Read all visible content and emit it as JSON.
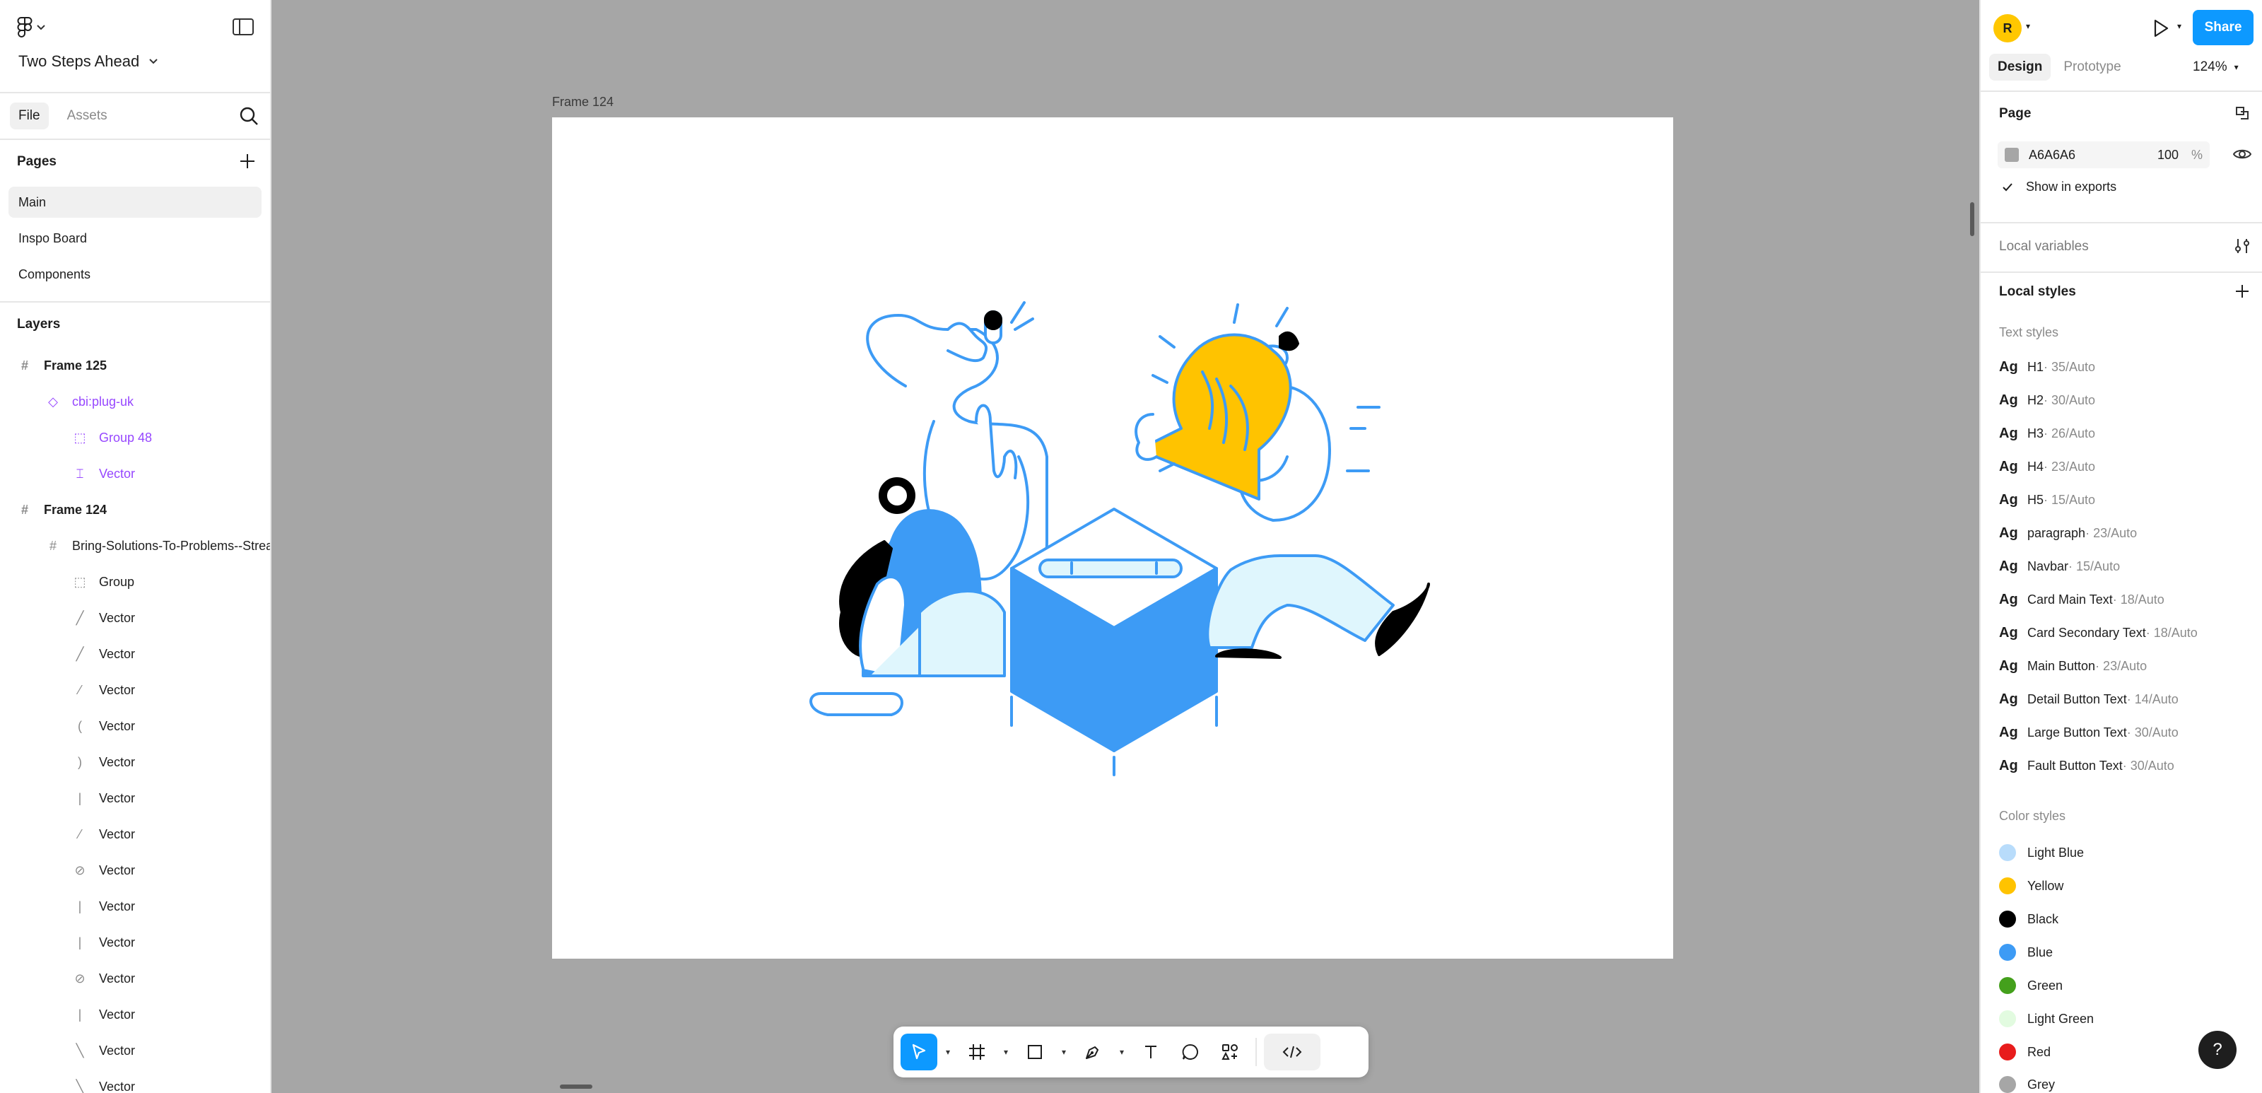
{
  "file": {
    "name": "Two Steps Ahead"
  },
  "left_panel": {
    "tabs": [
      {
        "label": "File"
      },
      {
        "label": "Assets"
      }
    ],
    "pages_title": "Pages",
    "pages": [
      {
        "label": "Main"
      },
      {
        "label": "Inspo Board"
      },
      {
        "label": "Components"
      }
    ],
    "layers_title": "Layers",
    "layers": [
      {
        "label": "Frame 125",
        "icon": "frame-icon"
      },
      {
        "label": "cbi:plug-uk",
        "icon": "component-icon"
      },
      {
        "label": "Group 48",
        "icon": "group-icon"
      },
      {
        "label": "Vector",
        "icon": "vector-icon"
      },
      {
        "label": "Frame 124",
        "icon": "frame-icon"
      },
      {
        "label": "Bring-Solutions-To-Problems--Streamline-Bangalore",
        "icon": "frame-icon"
      },
      {
        "label": "Group",
        "icon": "group-icon"
      },
      {
        "label": "Vector",
        "icon": "vector-icon"
      },
      {
        "label": "Vector",
        "icon": "vector-icon"
      },
      {
        "label": "Vector",
        "icon": "vector-icon"
      },
      {
        "label": "Vector",
        "icon": "vector-icon"
      },
      {
        "label": "Vector",
        "icon": "vector-icon"
      },
      {
        "label": "Vector",
        "icon": "vector-icon"
      },
      {
        "label": "Vector",
        "icon": "vector-icon"
      },
      {
        "label": "Vector",
        "icon": "vector-icon"
      },
      {
        "label": "Vector",
        "icon": "vector-icon"
      },
      {
        "label": "Vector",
        "icon": "vector-icon"
      },
      {
        "label": "Vector",
        "icon": "vector-icon"
      },
      {
        "label": "Vector",
        "icon": "vector-icon"
      },
      {
        "label": "Vector",
        "icon": "vector-icon"
      },
      {
        "label": "Vector",
        "icon": "vector-icon"
      }
    ]
  },
  "canvas": {
    "frame_label": "Frame 124",
    "background": "#A6A6A6",
    "illustration_colors": {
      "blue": "#3d9bf5",
      "light_blue": "#dff6fd",
      "yellow": "#ffc300",
      "black": "#000000"
    }
  },
  "toolbar": {
    "tools": [
      {
        "name": "move-tool-icon"
      },
      {
        "name": "frame-tool-icon"
      },
      {
        "name": "rectangle-tool-icon"
      },
      {
        "name": "pen-tool-icon"
      },
      {
        "name": "text-tool-icon"
      },
      {
        "name": "comment-tool-icon"
      },
      {
        "name": "actions-tool-icon"
      },
      {
        "name": "dev-mode-icon"
      }
    ]
  },
  "right_panel": {
    "avatar_initial": "R",
    "share_label": "Share",
    "tabs": [
      {
        "label": "Design"
      },
      {
        "label": "Prototype"
      }
    ],
    "zoom": "124%",
    "page_title": "Page",
    "page_bg_hex": "A6A6A6",
    "page_bg_opacity": "100",
    "percent_sign": "%",
    "show_in_exports": "Show in exports",
    "local_variables": "Local variables",
    "local_styles": "Local styles",
    "text_styles_title": "Text styles",
    "ag": "Ag",
    "text_styles": [
      {
        "name": "H1",
        "meta": " · 35/Auto"
      },
      {
        "name": "H2",
        "meta": " · 30/Auto"
      },
      {
        "name": "H3",
        "meta": " · 26/Auto"
      },
      {
        "name": "H4",
        "meta": " · 23/Auto"
      },
      {
        "name": "H5",
        "meta": " · 15/Auto"
      },
      {
        "name": "paragraph",
        "meta": " · 23/Auto"
      },
      {
        "name": "Navbar",
        "meta": " · 15/Auto"
      },
      {
        "name": "Card Main Text",
        "meta": " · 18/Auto"
      },
      {
        "name": "Card Secondary Text",
        "meta": " · 18/Auto"
      },
      {
        "name": "Main Button",
        "meta": " · 23/Auto"
      },
      {
        "name": "Detail Button Text",
        "meta": " · 14/Auto"
      },
      {
        "name": "Large Button Text",
        "meta": " · 30/Auto"
      },
      {
        "name": "Fault Button Text",
        "meta": " · 30/Auto"
      }
    ],
    "color_styles_title": "Color styles",
    "color_styles": [
      {
        "name": "Light Blue",
        "color": "#b8dcfb"
      },
      {
        "name": "Yellow",
        "color": "#ffc300"
      },
      {
        "name": "Black",
        "color": "#000000"
      },
      {
        "name": "Blue",
        "color": "#3d9bf5"
      },
      {
        "name": "Green",
        "color": "#44a01c"
      },
      {
        "name": "Light Green",
        "color": "#e2fbe0"
      },
      {
        "name": "Red",
        "color": "#e81c1c"
      },
      {
        "name": "Grey",
        "color": "#a6a6a6"
      }
    ],
    "help_label": "?"
  }
}
